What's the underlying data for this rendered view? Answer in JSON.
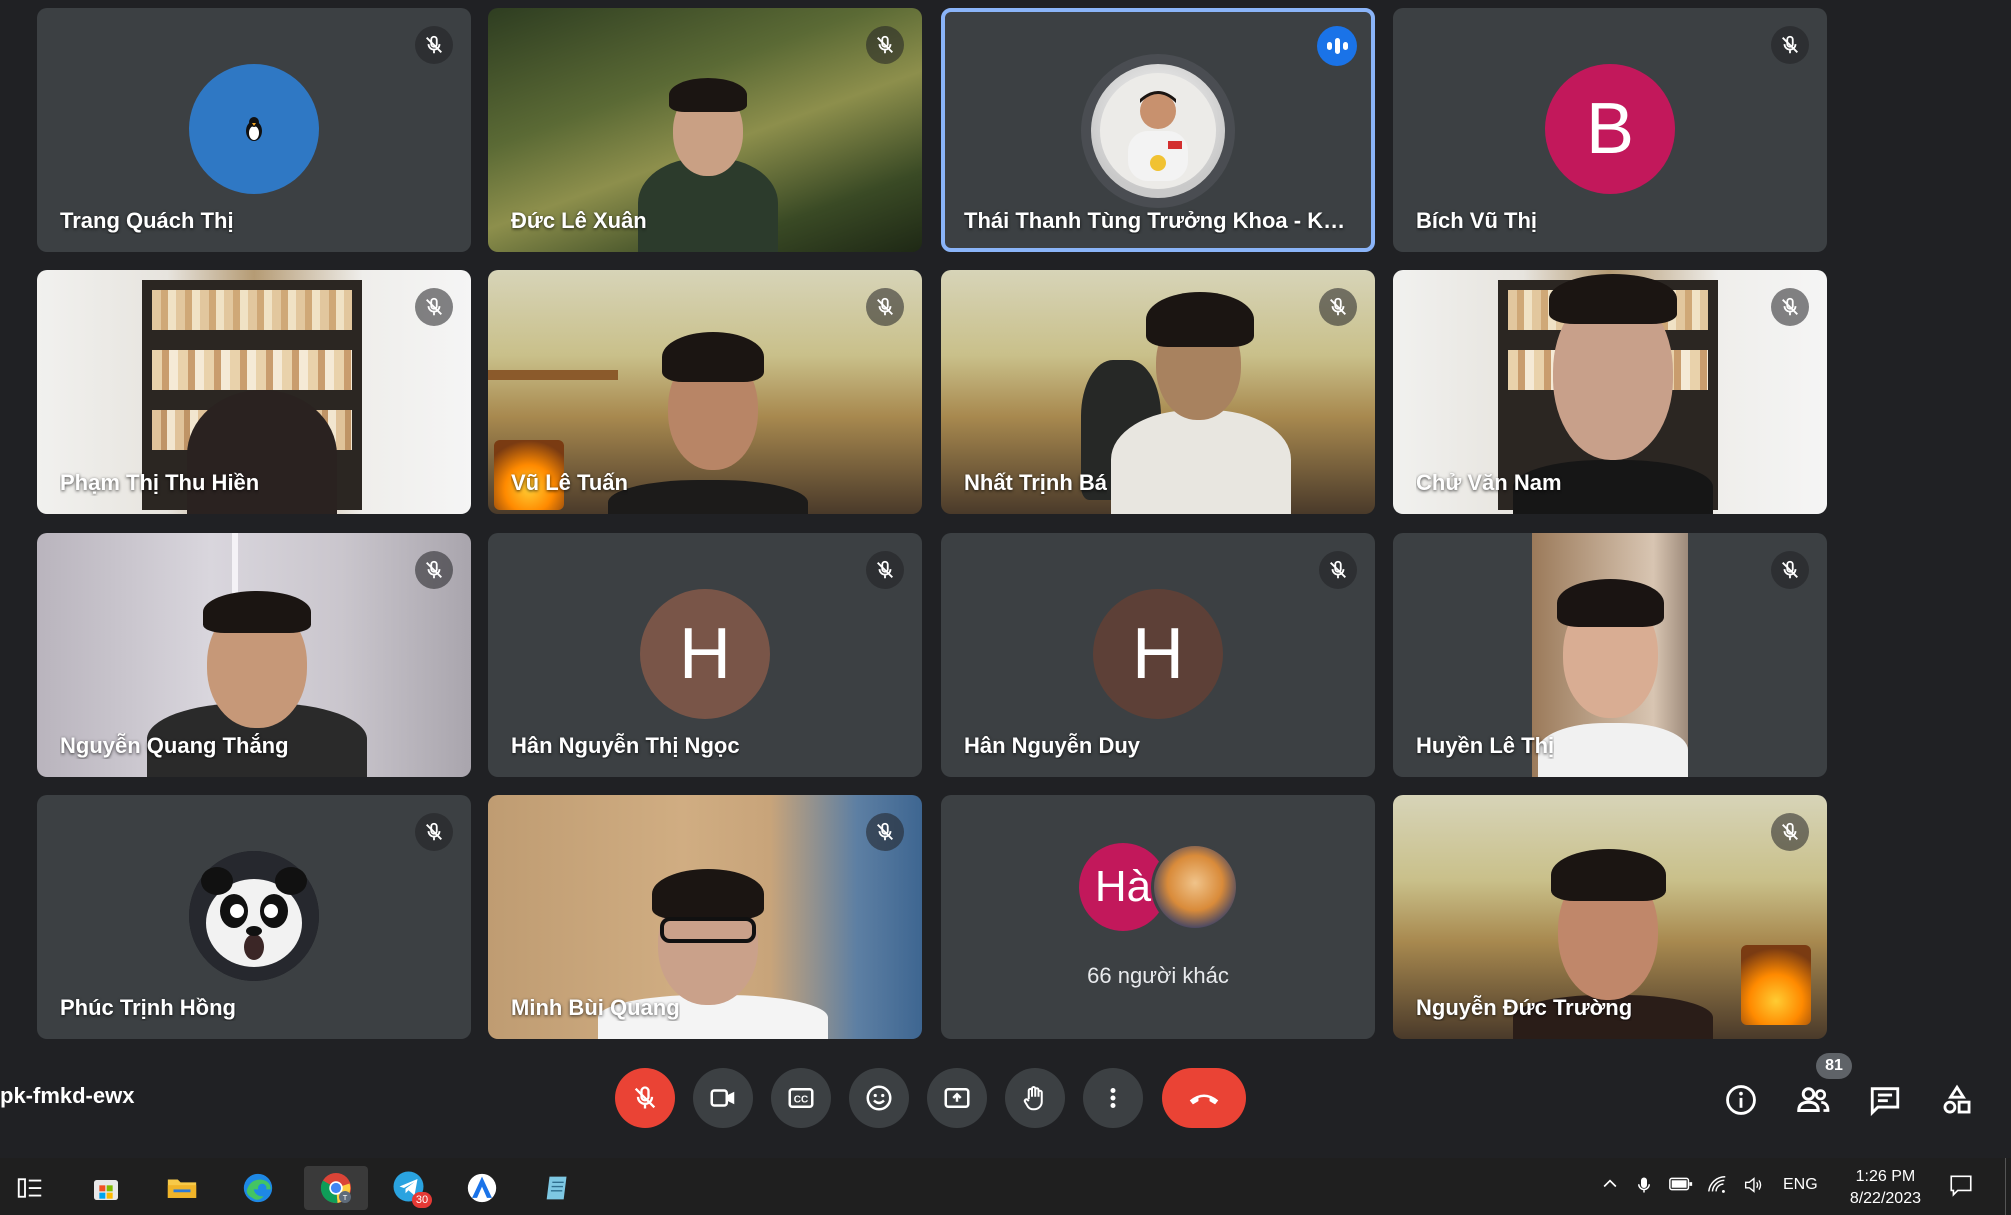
{
  "participants": [
    {
      "name": "Trang Quách Thị",
      "mic": "muted"
    },
    {
      "name": "Đức Lê Xuân",
      "mic": "muted"
    },
    {
      "name": "Thái Thanh Tùng Trưởng Khoa - Khoa ...",
      "mic": "speaking"
    },
    {
      "name": "Bích Vũ Thị",
      "mic": "muted",
      "initial": "B",
      "avatar_color": "#c2185b"
    },
    {
      "name": "Phạm Thị Thu Hiền",
      "mic": "muted"
    },
    {
      "name": "Vũ Lê Tuấn",
      "mic": "muted"
    },
    {
      "name": "Nhất Trịnh Bá",
      "mic": "muted"
    },
    {
      "name": "Chử Văn Nam",
      "mic": "muted"
    },
    {
      "name": "Nguyễn Quang Thắng",
      "mic": "muted"
    },
    {
      "name": "Hân Nguyễn Thị Ngọc",
      "mic": "muted",
      "initial": "H",
      "avatar_color": "#795548"
    },
    {
      "name": "Hân Nguyễn Duy",
      "mic": "muted",
      "initial": "H",
      "avatar_color": "#5d4037"
    },
    {
      "name": "Huyền Lê Thị",
      "mic": "muted"
    },
    {
      "name": "Phúc Trịnh Hồng",
      "mic": "muted"
    },
    {
      "name": "Minh Bùi Quang",
      "mic": "muted"
    },
    {
      "name": "Nguyễn Đức Trường",
      "mic": "muted"
    }
  ],
  "others_tile": {
    "initial": "Hà",
    "avatar_color": "#c2185b",
    "label": "66 người khác"
  },
  "meeting_code": "pk-fmkd-ewx",
  "controls": [
    "mic-off",
    "camera",
    "captions",
    "emoji",
    "present",
    "raise-hand",
    "more",
    "leave-call"
  ],
  "people_count": "81",
  "right_icons": [
    "info",
    "people",
    "chat",
    "activities"
  ],
  "taskbar": {
    "apps": [
      "task-view",
      "microsoft-store",
      "file-explorer",
      "edge",
      "chrome",
      "telegram",
      "app-a",
      "notepad"
    ],
    "telegram_badge": "30",
    "language": "ENG",
    "time": "1:26 PM",
    "date": "8/22/2023"
  },
  "colors": {
    "background": "#202124",
    "tile": "#3c4043",
    "accent": "#8ab4f8",
    "danger": "#ea4335",
    "speaking": "#1a73e8"
  }
}
